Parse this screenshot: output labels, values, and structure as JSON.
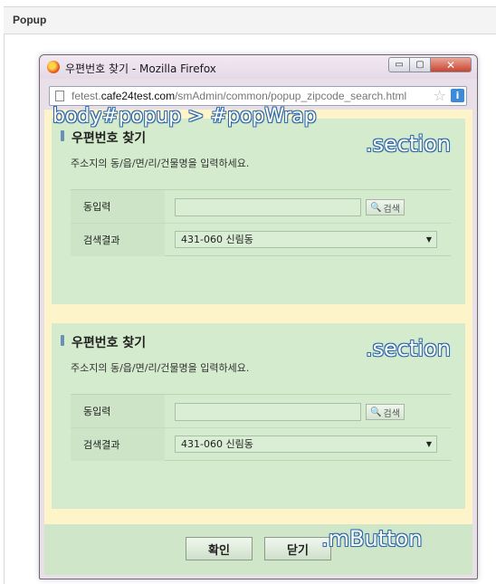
{
  "page": {
    "header_title": "Popup"
  },
  "window": {
    "title": "우편번호 찾기 - Mozilla Firefox",
    "url_prefix": "fetest.",
    "url_host": "cafe24test.com",
    "url_path": "/smAdmin/common/popup_zipcode_search.html",
    "min_label": "▭",
    "max_label": "▢",
    "close_label": "✕",
    "info_label": "i",
    "star_label": "☆"
  },
  "annotations": {
    "popwrap": "body#popup > #popWrap",
    "section": ".section",
    "mbutton": ".mButton"
  },
  "sections": [
    {
      "heading": "우편번호 찾기",
      "description": "주소지의 동/읍/면/리/건물명을 입력하세요.",
      "row1_label": "동입력",
      "input_value": "",
      "search_label": "검색",
      "row2_label": "검색결과",
      "result_value": "431-060 신림동"
    },
    {
      "heading": "우편번호 찾기",
      "description": "주소지의 동/읍/면/리/건물명을 입력하세요.",
      "row1_label": "동입력",
      "input_value": "",
      "search_label": "검색",
      "row2_label": "검색결과",
      "result_value": "431-060 신림동"
    }
  ],
  "buttons": {
    "ok_label": "확인",
    "close_label": "닫기"
  },
  "colors": {
    "popwrap_bg": "#fdf5c9",
    "section_bg": "#d4ebcd",
    "annotation_text": "#ffffff",
    "annotation_outline": "#2e6aa8"
  }
}
